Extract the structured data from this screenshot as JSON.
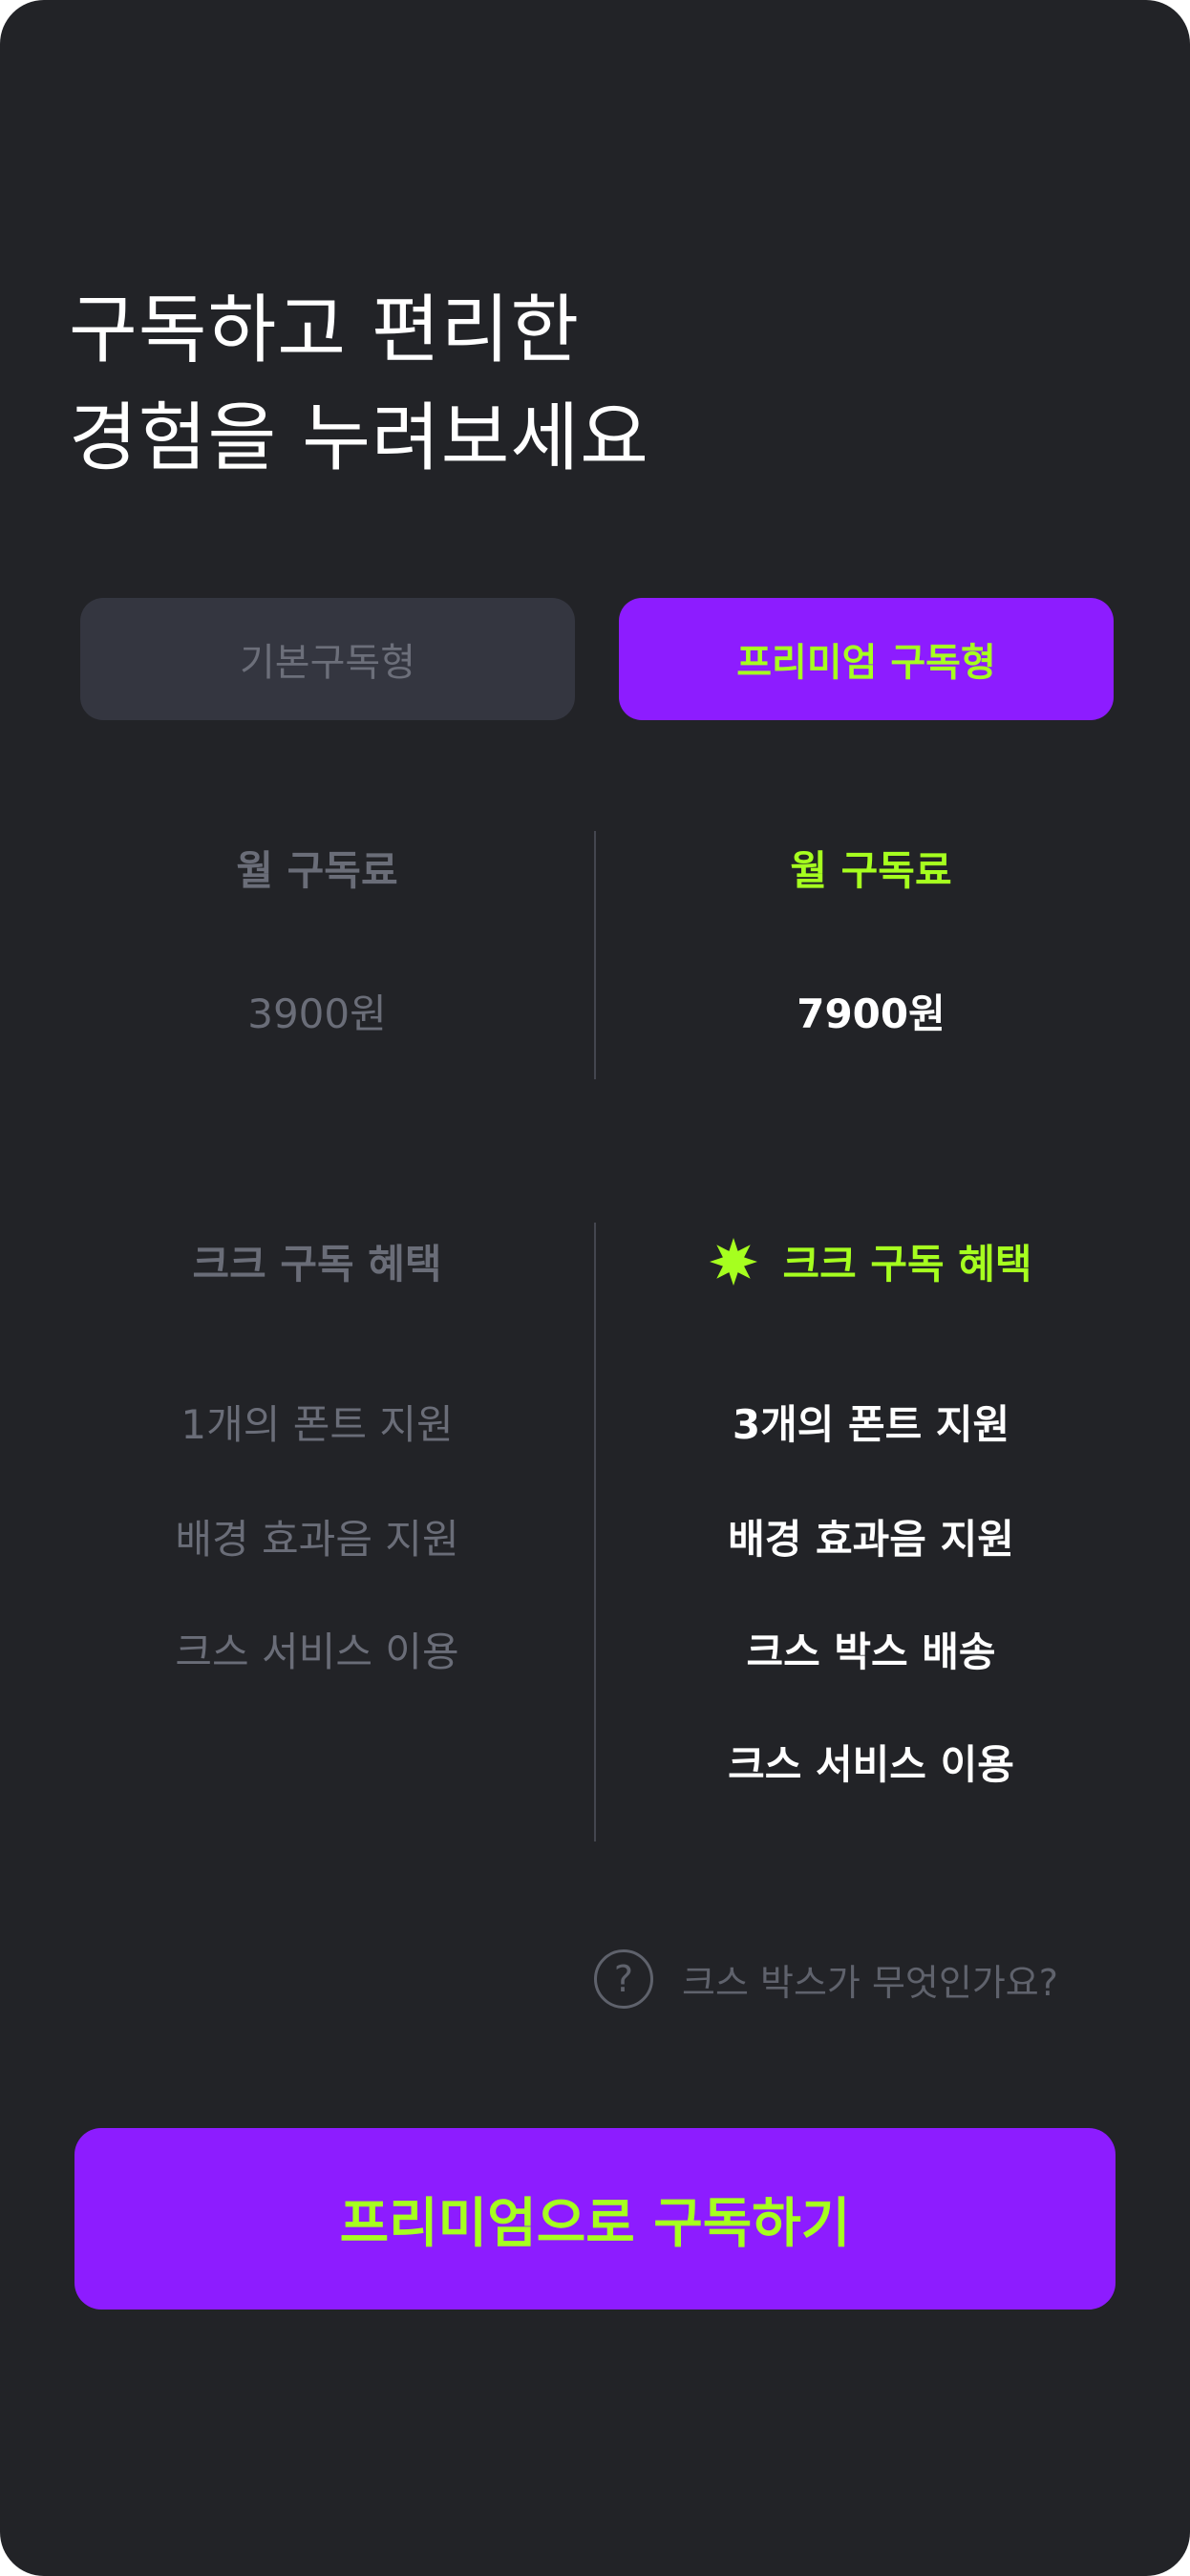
{
  "header": {
    "line1": "구독하고 편리한",
    "line2": "경험을 누려보세요"
  },
  "tabs": {
    "basic_label": "기본구독형",
    "premium_label": "프리미엄 구독형",
    "selected": "premium"
  },
  "pricing": {
    "basic": {
      "label": "월 구독료",
      "price": "3900원"
    },
    "premium": {
      "label": "월 구독료",
      "price": "7900원"
    }
  },
  "benefits": {
    "basic": {
      "title": "크크 구독 혜택",
      "items": [
        "1개의 폰트 지원",
        "배경 효과음 지원",
        "크스 서비스 이용"
      ]
    },
    "premium": {
      "title": "크크 구독 혜택",
      "icon": "burst-star-icon",
      "items": [
        "3개의 폰트 지원",
        "배경 효과음 지원",
        "크스 박스 배송",
        "크스 서비스 이용"
      ]
    }
  },
  "help": {
    "icon": "question-circle-icon",
    "icon_glyph": "?",
    "text": "크스 박스가 무엇인가요?"
  },
  "cta": {
    "label": "프리미엄으로 구독하기"
  },
  "colors": {
    "background": "#222327",
    "accent_purple": "#8d1cff",
    "accent_lime": "#a6ff1f",
    "inactive_tab": "#343640",
    "muted_text": "#6a6d78"
  }
}
